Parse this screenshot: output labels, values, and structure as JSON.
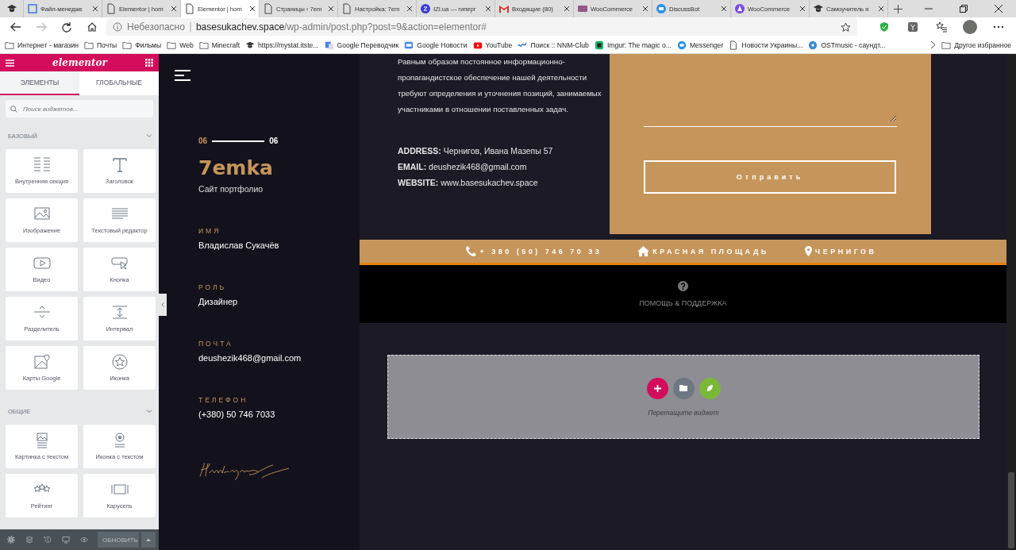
{
  "browser": {
    "tabs": [
      {
        "selected": false
      },
      {
        "title": "Файл-менедже",
        "selected": false
      },
      {
        "title": "Elementor | hom",
        "selected": false
      },
      {
        "title": "Elementor | hom",
        "selected": true
      },
      {
        "title": "Страницы ‹ 7em",
        "selected": false
      },
      {
        "title": "Настройка: 7em",
        "selected": false
      },
      {
        "title": "IZI.ua — гиперг",
        "selected": false
      },
      {
        "title": "Входящие (80)",
        "selected": false
      },
      {
        "title": "WooCommerce",
        "selected": false
      },
      {
        "title": "DiscussBot",
        "selected": false
      },
      {
        "title": "WooCommerce",
        "selected": false
      },
      {
        "title": "Самоучитель я",
        "selected": false
      }
    ],
    "address": {
      "security": "Небезопасно",
      "host": "basesukachev.space",
      "path": "/wp-admin/post.php?post=9&action=elementor#"
    },
    "bookmarks": [
      {
        "label": "Интернет - магазин"
      },
      {
        "label": "Почты"
      },
      {
        "label": "Фильмы"
      },
      {
        "label": "Web"
      },
      {
        "label": "Minecraft"
      },
      {
        "label": "https://mystat.itste..."
      },
      {
        "label": "Google Переводчик"
      },
      {
        "label": "Google Новости"
      },
      {
        "label": "YouTube"
      },
      {
        "label": "Поиск :: NNM-Club"
      },
      {
        "label": "Imgur: The magic o..."
      },
      {
        "label": "Messenger"
      },
      {
        "label": "Новости Украины..."
      },
      {
        "label": "OSTmusic - саундт..."
      }
    ],
    "other_bookmarks": "Другое избранное"
  },
  "panel": {
    "logo": "elementor",
    "tabs": [
      {
        "label": "ЭЛЕМЕНТЫ",
        "selected": true
      },
      {
        "label": "ГЛОБАЛЬНЫЕ",
        "selected": false
      }
    ],
    "search": {
      "placeholder": "Поиск виджетов..."
    },
    "categories": [
      {
        "title": "БАЗОВЫЙ",
        "expanded": true,
        "widgets": [
          {
            "label": "Внутренняя секция"
          },
          {
            "label": "Заголовок"
          },
          {
            "label": "Изображение"
          },
          {
            "label": "Текстовый редактор"
          },
          {
            "label": "Видео"
          },
          {
            "label": "Кнопка"
          },
          {
            "label": "Разделитель"
          },
          {
            "label": "Интервал"
          },
          {
            "label": "Карты Google"
          },
          {
            "label": "Иконка"
          }
        ]
      },
      {
        "title": "ОБЩИЕ",
        "expanded": true,
        "widgets": [
          {
            "label": "Картинка с текстом"
          },
          {
            "label": "Иконка с текстом"
          },
          {
            "label": "Рейтинг"
          },
          {
            "label": "Карусель"
          }
        ]
      }
    ],
    "update_button": "ОБНОВИТЬ"
  },
  "preview": {
    "sidebar": {
      "counter": {
        "current": "06",
        "total": "06"
      },
      "title": "7emka",
      "subtitle": "Сайт портфолио",
      "fields": [
        {
          "label": "ИМЯ",
          "value": "Владислав Сукачёв"
        },
        {
          "label": "РОЛЬ",
          "value": "Дизайнер"
        },
        {
          "label": "ПОЧТА",
          "value": "deushezik468@gmail.com"
        },
        {
          "label": "ТЕЛЕФОН",
          "value": "(+380) 50 746 7033"
        }
      ]
    },
    "about": {
      "paragraph": "Равным образом постоянное информационно-пропагандистское обеспечение нашей деятельности требуют определения и уточнения позиций, занимаемых участниками в отношении поставленных задач.",
      "contacts": [
        {
          "label": "ADDRESS:",
          "value": "Чернигов, Ивана Мазепы 57"
        },
        {
          "label": "EMAIL:",
          "value": "deushezik468@gmail.com"
        },
        {
          "label": "WEBSITE:",
          "value": "www.basesukachev.space"
        }
      ]
    },
    "form": {
      "button": "Отправить"
    },
    "info_bar": [
      {
        "text": "+ 380 (50) 746 70 33"
      },
      {
        "text": "КРАСНАЯ ПЛОЩАДЬ"
      },
      {
        "text": "ЧЕРНИГОВ"
      }
    ],
    "help": {
      "label": "ПОМОЩЬ & ПОДДЕРЖКА"
    },
    "dropzone": {
      "hint": "Перетащите виджет"
    }
  }
}
